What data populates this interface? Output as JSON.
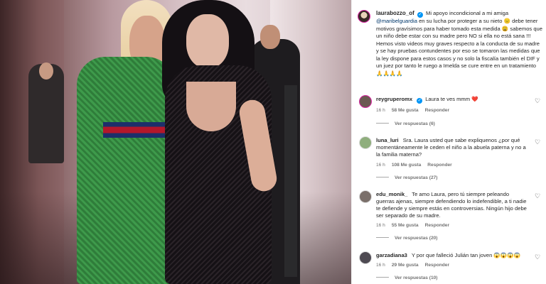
{
  "post": {
    "author": "laurabozzo_of",
    "caption_parts": {
      "before_mention": "Mi apoyo incondicional a mi amiga ",
      "mention": "@maribelguardia",
      "after_mention": " en su lucha por proteger a su nieto 😑 debe tener motivos gravísimos para haber tomado esta medida 😩 sabemos que un niño debe estar con su madre pero NO si ella no está sana !!! Hemos visto videos muy graves respecto a la conducta de su madre y se hay pruebas contundentes por eso se tomaron las medidas que la ley dispone para estos casos y no solo la fiscalía también el DIF y un juez por tanto le ruego a Imelda se cure entre en un tratamiento 🙏🙏🙏🙏"
    }
  },
  "comments": [
    {
      "user": "reygruperomx",
      "verified": true,
      "text": "Laura te ves mmm ❤️",
      "time": "16 h",
      "likes": "58 Me gusta",
      "reply": "Responder",
      "replies": "Ver respuestas (6)",
      "avatar_color": "#6b5a52",
      "avatar_ring": "#d6249f"
    },
    {
      "user": "luna_luri",
      "verified": false,
      "text": "Sra. Laura usted que sabe expliquenos ¿por qué momentáneamente le ceden el niño a la abuela paterna y no a la familia materna?",
      "time": "16 h",
      "likes": "108 Me gusta",
      "reply": "Responder",
      "replies": "Ver respuestas (27)",
      "avatar_color": "#8fae7d",
      "avatar_ring": "#dddddd"
    },
    {
      "user": "edu_monik_",
      "verified": false,
      "text": "Te amo Laura, pero tú siempre peleando guerras ajenas, siempre defendiendo lo indefendible, a ti nadie te defiende y siempre estás en controversias. Ningún hijo debe ser separado de su madre.",
      "time": "16 h",
      "likes": "55 Me gusta",
      "reply": "Responder",
      "replies": "Ver respuestas (20)",
      "avatar_color": "#7a6f6a",
      "avatar_ring": "#dddddd"
    },
    {
      "user": "garzadiana3",
      "verified": false,
      "text": "Y por que falleció Julián tan joven 😱😱😱😱",
      "time": "16 h",
      "likes": "29 Me gusta",
      "reply": "Responder",
      "replies": "Ver respuestas (10)",
      "avatar_color": "#4e4a52",
      "avatar_ring": "#dddddd"
    }
  ],
  "icons": {
    "heart": "♡",
    "verified": "✓",
    "more": "···"
  },
  "colors": {
    "mention": "#00376b",
    "meta": "#737373",
    "verified": "#0095f6"
  }
}
